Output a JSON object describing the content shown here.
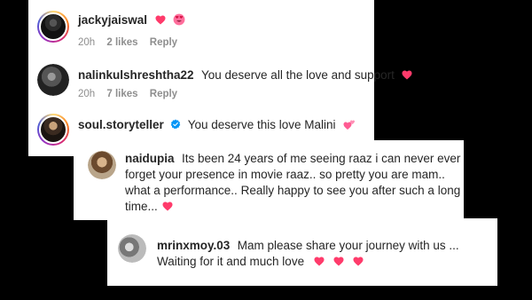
{
  "comments": [
    {
      "username": "jackyjaiswal",
      "text": "",
      "time": "20h",
      "likes": "2 likes",
      "reply": "Reply",
      "icons": [
        "heart-icon",
        "heart-eyes-emoji-icon"
      ]
    },
    {
      "username": "nalinkulshreshtha22",
      "text": "You deserve all the love and support",
      "time": "20h",
      "likes": "7 likes",
      "reply": "Reply",
      "icons": [
        "heart-icon"
      ]
    },
    {
      "username": "soul.storyteller",
      "text": "You deserve this love Malini",
      "icons": [
        "verified-badge-icon",
        "two-hearts-icon"
      ]
    },
    {
      "username": "naidupia",
      "text_lines": [
        "Its been 24 years of me seeing raaz i can never ever",
        "forget your presence in movie raaz.. so pretty you are mam..",
        "what a performance.. Really happy to see you after such a long",
        "time..."
      ],
      "icons": [
        "heart-icon"
      ]
    },
    {
      "username": "mrinxmoy.03",
      "text_lines": [
        "Mam please share your journey with us ...",
        "Waiting for it and much love"
      ],
      "icons": [
        "heart-icon",
        "heart-icon",
        "heart-icon"
      ]
    }
  ],
  "colors": {
    "heart": "#ff3b6b",
    "verified": "#0095f6",
    "meta_text": "#8e8e8e",
    "background": "#000000",
    "card": "#ffffff"
  }
}
